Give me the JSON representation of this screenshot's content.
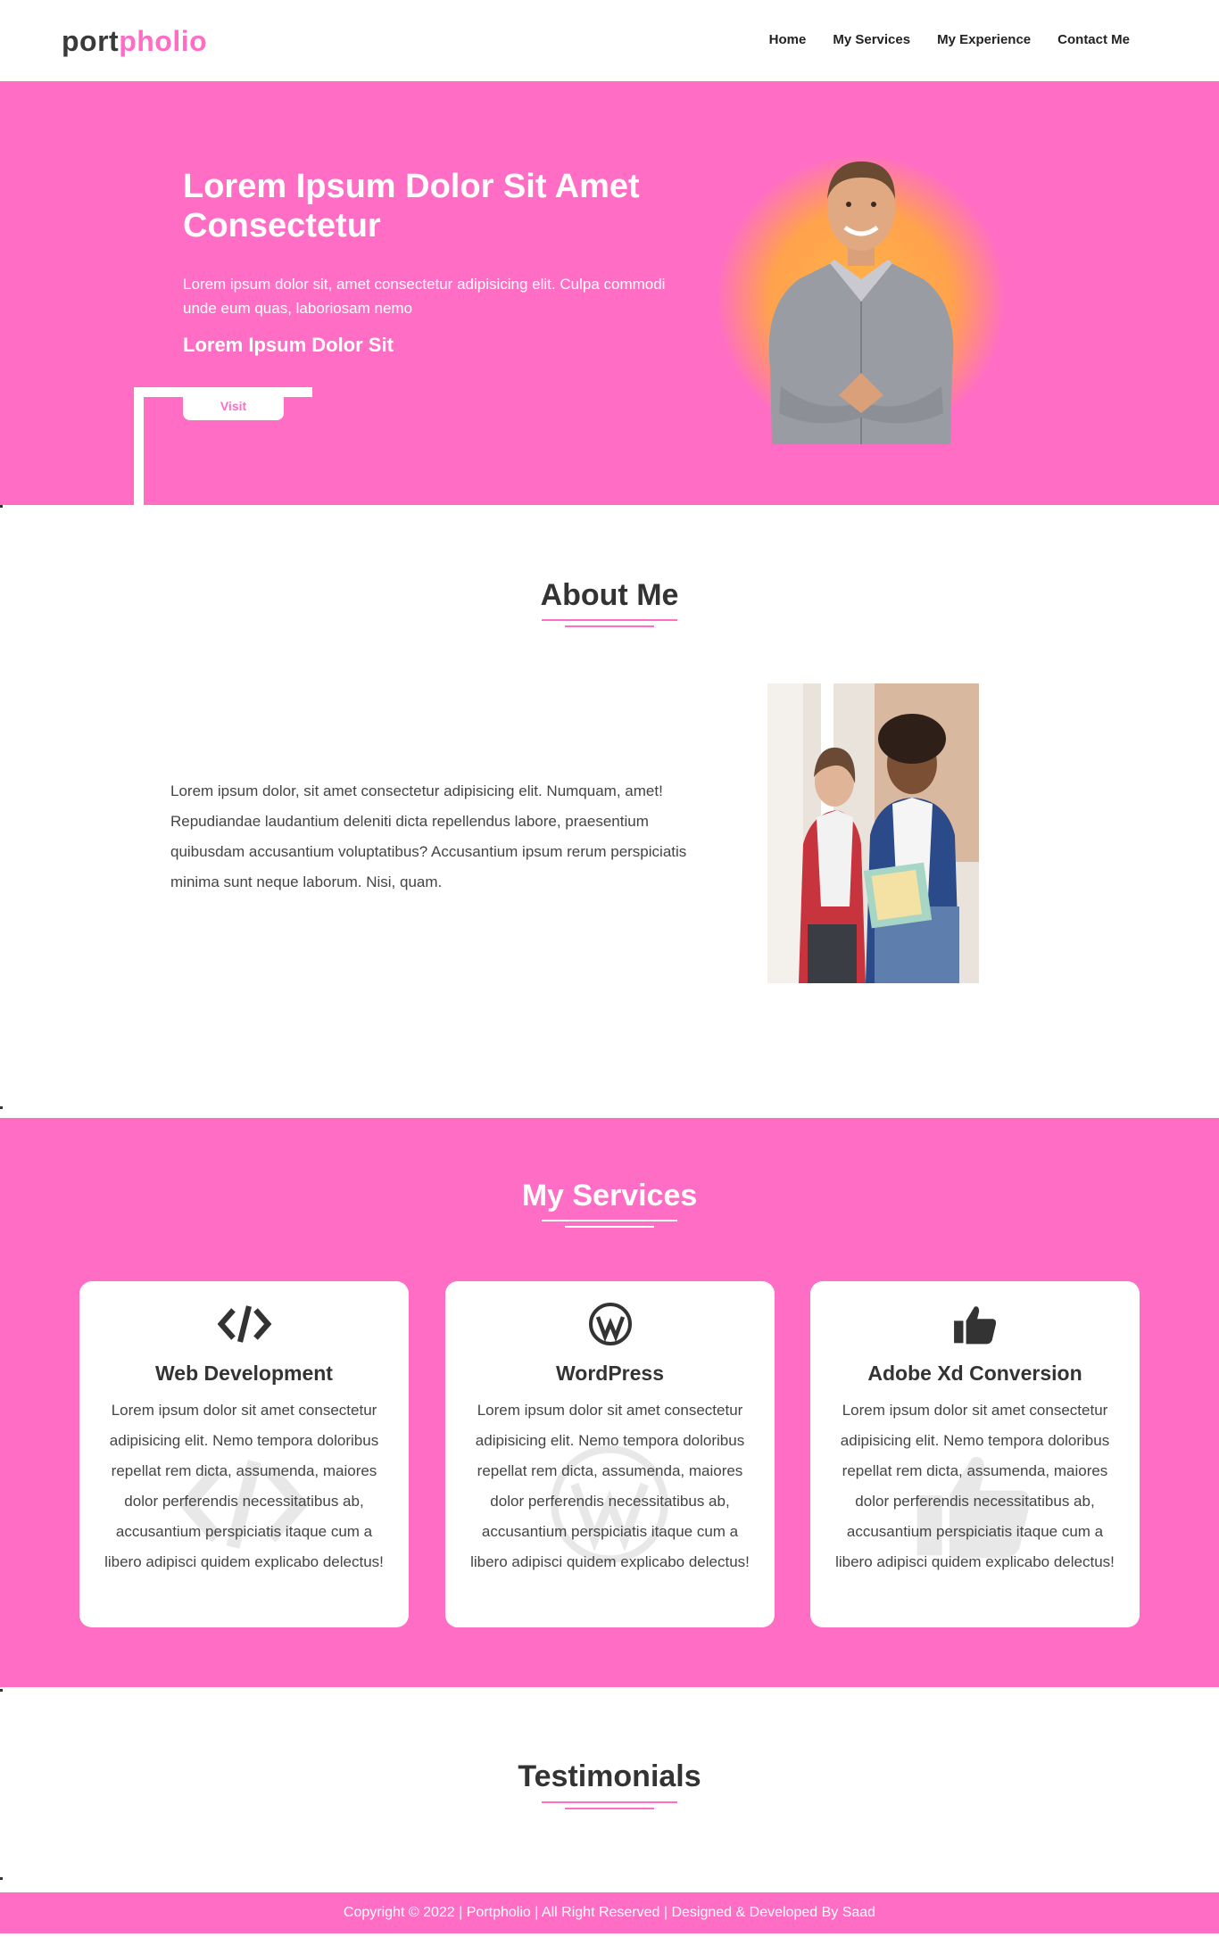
{
  "header": {
    "logo_part1": "port",
    "logo_part2": "pholio",
    "nav": [
      "Home",
      "My Services",
      "My Experience",
      "Contact Me"
    ]
  },
  "hero": {
    "title": "Lorem Ipsum Dolor Sit Amet Consectetur",
    "description": "Lorem ipsum dolor sit, amet consectetur adipisicing elit. Culpa commodi unde eum quas, laboriosam nemo",
    "subtitle": "Lorem Ipsum Dolor Sit",
    "button_label": "Visit"
  },
  "about": {
    "title": "About Me",
    "text": "Lorem ipsum dolor, sit amet consectetur adipisicing elit. Numquam, amet! Repudiandae laudantium deleniti dicta repellendus labore, praesentium quibusdam accusantium voluptatibus? Accusantium ipsum rerum perspiciatis minima sunt neque laborum. Nisi, quam."
  },
  "services": {
    "title": "My Services",
    "cards": [
      {
        "icon": "code-icon",
        "title": "Web Development",
        "text": "Lorem ipsum dolor sit amet consectetur adipisicing elit. Nemo tempora doloribus repellat rem dicta, assumenda, maiores dolor perferendis necessitatibus ab, accusantium perspiciatis itaque cum a libero adipisci quidem explicabo delectus!"
      },
      {
        "icon": "wordpress-icon",
        "title": "WordPress",
        "text": "Lorem ipsum dolor sit amet consectetur adipisicing elit. Nemo tempora doloribus repellat rem dicta, assumenda, maiores dolor perferendis necessitatibus ab, accusantium perspiciatis itaque cum a libero adipisci quidem explicabo delectus!"
      },
      {
        "icon": "thumbs-up-icon",
        "title": "Adobe Xd Conversion",
        "text": "Lorem ipsum dolor sit amet consectetur adipisicing elit. Nemo tempora doloribus repellat rem dicta, assumenda, maiores dolor perferendis necessitatibus ab, accusantium perspiciatis itaque cum a libero adipisci quidem explicabo delectus!"
      }
    ]
  },
  "testimonials": {
    "title": "Testimonials"
  },
  "footer": {
    "text": "Copyright © 2022 | Portpholio | All Right Reserved | Designed & Developed By Saad"
  },
  "colors": {
    "accent": "#ff6ec4",
    "text": "#333333",
    "glow": "#ffa24d"
  }
}
